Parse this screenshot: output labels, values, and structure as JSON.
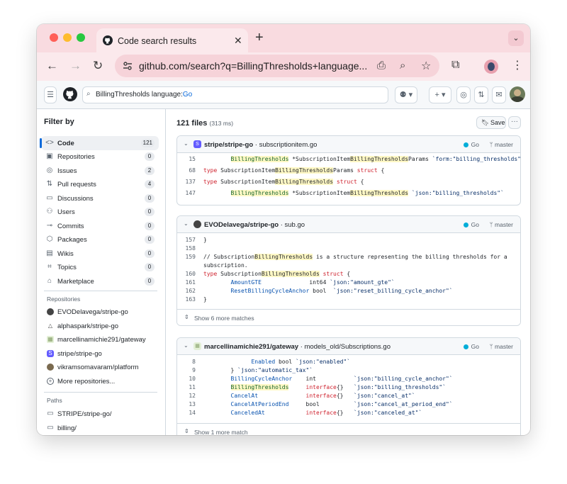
{
  "browser": {
    "tab_title": "Code search results",
    "url": "github.com/search?q=BillingThresholds+language...",
    "icons": [
      "close-icon",
      "new-tab-icon",
      "back-icon",
      "forward-icon",
      "reload-icon",
      "site-info-icon",
      "install-icon",
      "zoom-icon",
      "bookmark-icon",
      "extensions-icon",
      "profile-icon",
      "menu-icon"
    ]
  },
  "header": {
    "search_query": "BillingThresholds language:",
    "search_lang": "Go"
  },
  "sidebar": {
    "title": "Filter by",
    "items": [
      {
        "label": "Code",
        "count": "121",
        "icon": "<>"
      },
      {
        "label": "Repositories",
        "count": "0",
        "icon": "▣"
      },
      {
        "label": "Issues",
        "count": "2",
        "icon": "◎"
      },
      {
        "label": "Pull requests",
        "count": "4",
        "icon": "⇅"
      },
      {
        "label": "Discussions",
        "count": "0",
        "icon": "▭"
      },
      {
        "label": "Users",
        "count": "0",
        "icon": "⚇"
      },
      {
        "label": "Commits",
        "count": "0",
        "icon": "⊸"
      },
      {
        "label": "Packages",
        "count": "0",
        "icon": "⬡"
      },
      {
        "label": "Wikis",
        "count": "0",
        "icon": "▤"
      },
      {
        "label": "Topics",
        "count": "0",
        "icon": "⌗"
      },
      {
        "label": "Marketplace",
        "count": "0",
        "icon": "⌂"
      }
    ],
    "repos_heading": "Repositories",
    "repos": [
      "EVODelavega/stripe-go",
      "alphaspark/stripe-go",
      "marcellinamichie291/gateway",
      "stripe/stripe-go",
      "vikramsomavaram/platform",
      "More repositories..."
    ],
    "paths_heading": "Paths",
    "paths": [
      "STRIPE/stripe-go/",
      "billing/"
    ]
  },
  "main": {
    "results_count": "121 files",
    "results_time": "(313 ms)",
    "save_label": "Save",
    "results": [
      {
        "repo": "stripe/stripe-go",
        "path": " · subscriptionitem.go",
        "lang": "Go",
        "branch": "master",
        "footer": ""
      },
      {
        "repo": "EVODelavega/stripe-go",
        "path": " · sub.go",
        "lang": "Go",
        "branch": "master",
        "footer": "Show 6 more matches"
      },
      {
        "repo": "marcellinamichie291/gateway",
        "path": " · models_old/Subscriptions.go",
        "lang": "Go",
        "branch": "master",
        "footer": "Show 1 more match"
      }
    ],
    "line_numbers": {
      "r1": [
        "15",
        "68",
        "137",
        "147"
      ],
      "r2": [
        "157",
        "158",
        "159",
        "",
        "160",
        "161",
        "162",
        "163"
      ],
      "r3": [
        "8",
        "9",
        "10",
        "11",
        "12",
        "13",
        "14"
      ]
    }
  },
  "colors": {
    "accent": "#0969da",
    "tabstrip": "#f9dbe0",
    "highlight": "#fff8c5",
    "go_lang": "#00add8"
  }
}
